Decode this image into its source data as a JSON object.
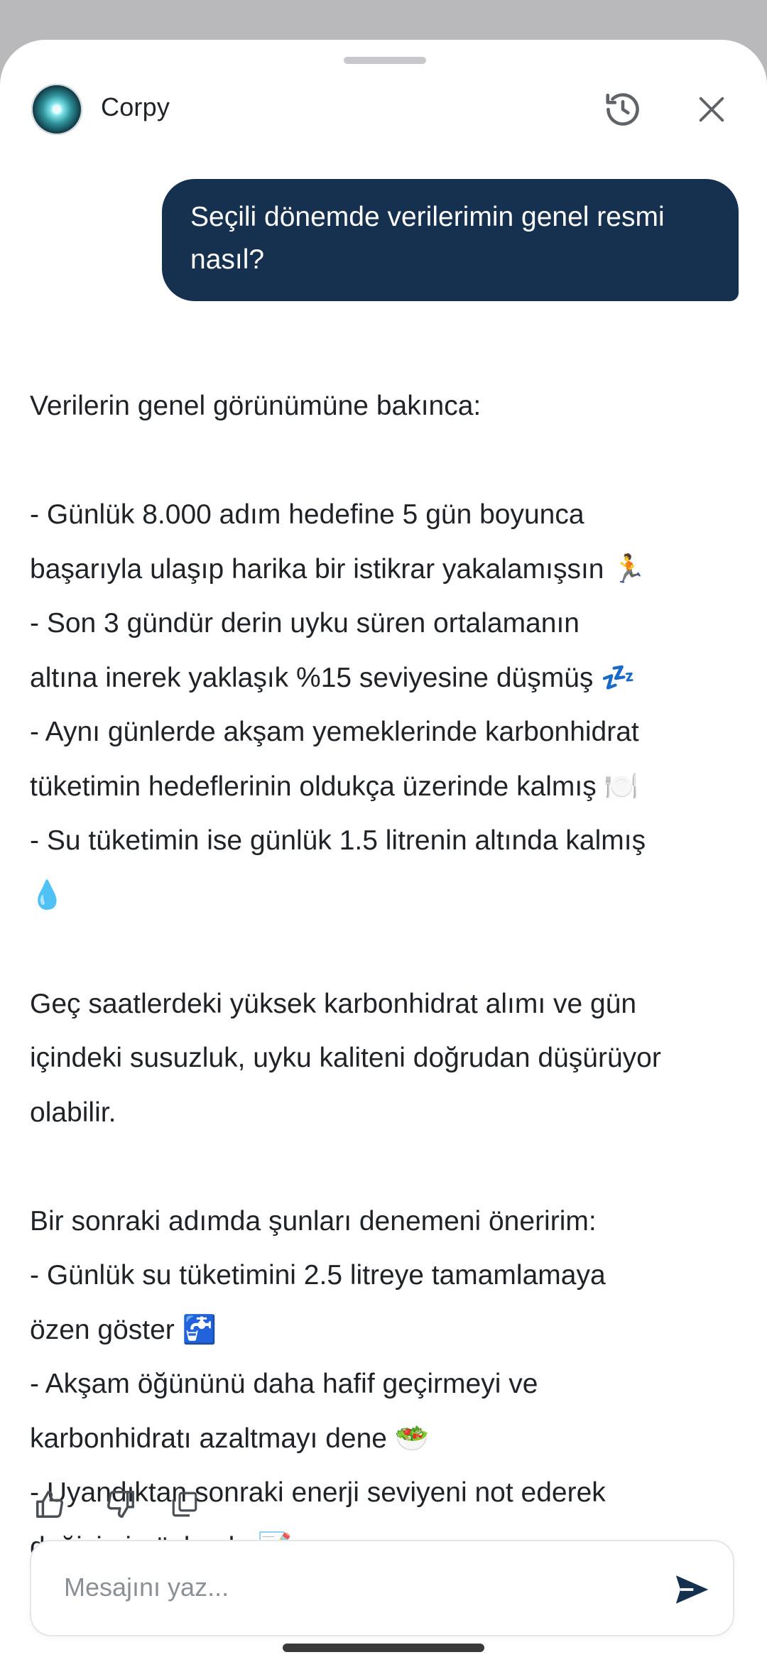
{
  "header": {
    "app_name": "Corpy"
  },
  "user_message": "Seçili dönemde verilerimin genel resmi nasıl?",
  "assistant_message": {
    "intro": "Verilerin genel görünümüne bakınca:",
    "bullets_1": [
      "- Günlük 8.000 adım hedefine 5 gün boyunca",
      "başarıyla ulaşıp harika bir istikrar yakalamışsın 🏃",
      "- Son 3 gündür derin uyku süren ortalamanın",
      "altına inerek yaklaşık %15 seviyesine düşmüş 💤",
      "- Aynı günlerde akşam yemeklerinde karbonhidrat",
      "tüketimin hedeflerinin oldukça üzerinde kalmış 🍽️",
      "- Su tüketimin ise günlük 1.5 litrenin altında kalmış",
      "💧"
    ],
    "insight": [
      "Geç saatlerdeki yüksek karbonhidrat alımı ve gün",
      "içindeki susuzluk, uyku kaliteni doğrudan düşürüyor",
      "olabilir."
    ],
    "suggestions": [
      "Bir sonraki adımda şunları denemeni öneririm:",
      "- Günlük su tüketimini 2.5 litreye tamamlamaya",
      "özen göster 🚰",
      "- Akşam öğününü daha hafif geçirmeyi ve",
      "karbonhidratı azaltmayı dene 🥗",
      "- Uyandıktan sonraki enerji seviyeni not ederek",
      "değişimi gözlemle 📝"
    ]
  },
  "composer": {
    "placeholder": "Mesajını yaz..."
  },
  "colors": {
    "user_bubble": "#15314f",
    "text": "#1f2328",
    "send_icon": "#15314f"
  },
  "icons": [
    "history-icon",
    "close-icon",
    "thumbs-up-icon",
    "thumbs-down-icon",
    "copy-icon",
    "send-icon"
  ]
}
